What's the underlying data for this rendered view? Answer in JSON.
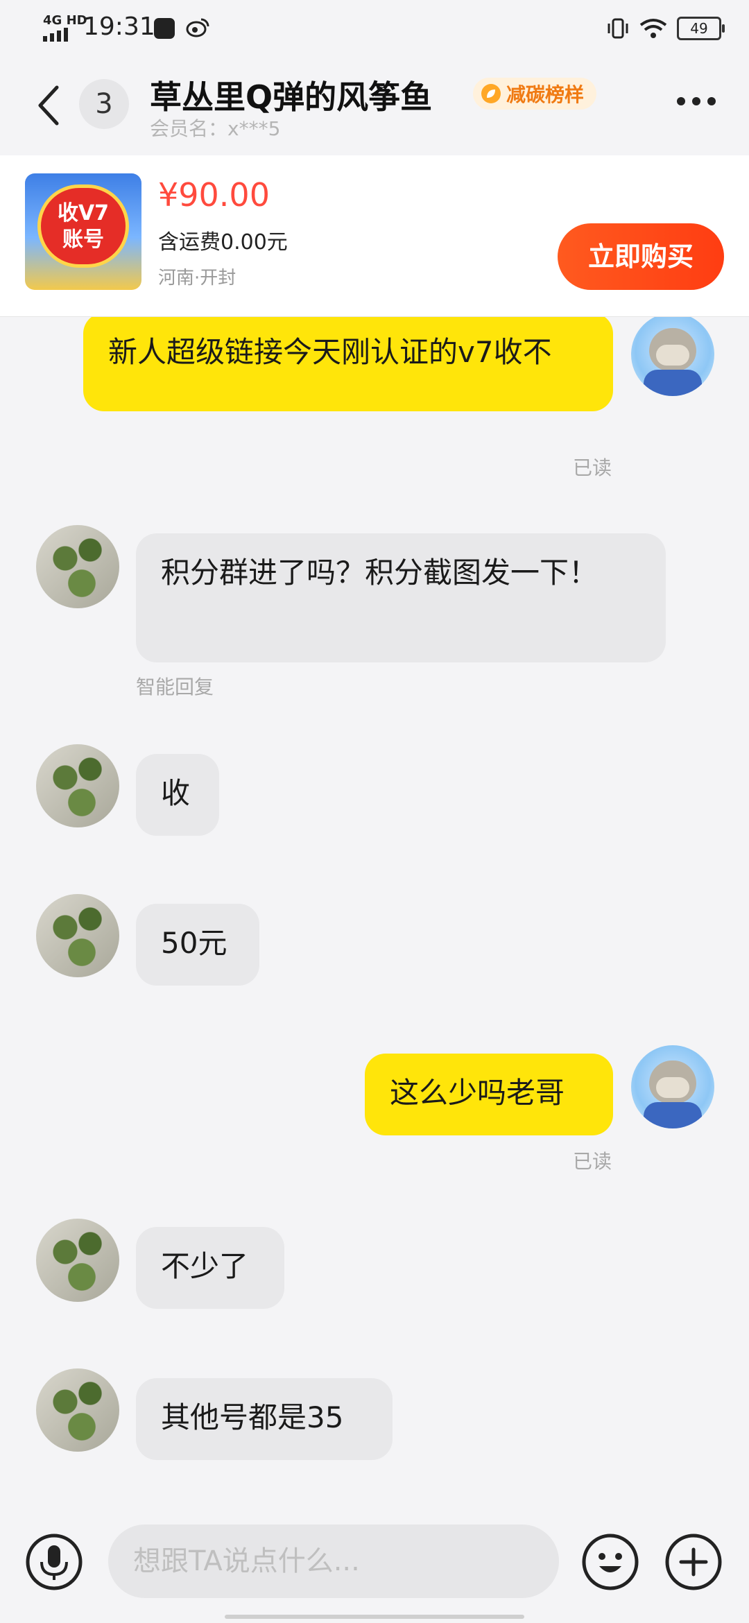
{
  "status_bar": {
    "network": "4G HD",
    "time": "19:31",
    "battery": "49"
  },
  "header": {
    "unread_count": "3",
    "title": "草丛里Q弹的风筝鱼",
    "badge": "减碳榜样",
    "member": "会员名：x***5"
  },
  "product": {
    "thumb_text_line1": "收V7",
    "thumb_text_line2": "账号",
    "price": "¥90.00",
    "shipping": "含运费0.00元",
    "location": "河南·开封",
    "buy_label": "立即购买"
  },
  "messages": [
    {
      "from": "me",
      "text": "新人超级链接今天刚认证的v7收不",
      "meta": "已读"
    },
    {
      "from": "them",
      "text": "积分群进了吗？积分截图发一下！",
      "meta": "智能回复"
    },
    {
      "from": "them",
      "text": "收",
      "meta": ""
    },
    {
      "from": "them",
      "text": "50元",
      "meta": ""
    },
    {
      "from": "me",
      "text": "这么少吗老哥",
      "meta": "已读"
    },
    {
      "from": "them",
      "text": "不少了",
      "meta": ""
    },
    {
      "from": "them",
      "text": "其他号都是35",
      "meta": ""
    }
  ],
  "input": {
    "placeholder": "想跟TA说点什么..."
  },
  "colors": {
    "accent_yellow": "#ffe50a",
    "buy_orange": "#ff4a1a",
    "price_red": "#ff4a3d",
    "badge_orange": "#f07a12"
  },
  "icons": [
    "back-arrow-icon",
    "more-icon",
    "mic-icon",
    "emoji-icon",
    "plus-icon",
    "wifi-icon",
    "signal-icon",
    "vibrate-icon",
    "weibo-icon"
  ]
}
